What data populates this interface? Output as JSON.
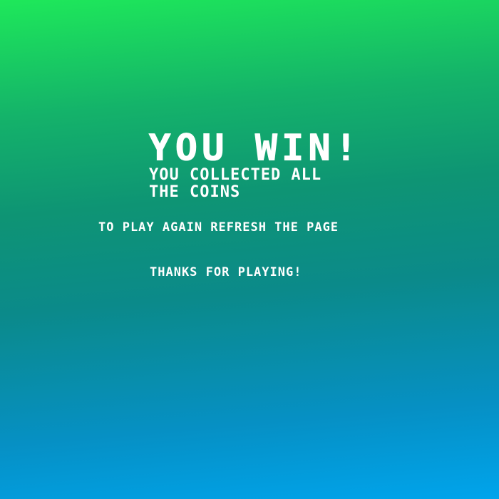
{
  "end_screen": {
    "title": "YOU WIN!",
    "subtitle_line1": "YOU COLLECTED ALL",
    "subtitle_line2": "THE COINS",
    "instruction": "TO PLAY AGAIN REFRESH THE PAGE",
    "thanks": "THANKS FOR PLAYING!"
  },
  "colors": {
    "background_top": "#1ee85a",
    "background_bottom": "#00a4ec",
    "text": "#ffffff"
  }
}
